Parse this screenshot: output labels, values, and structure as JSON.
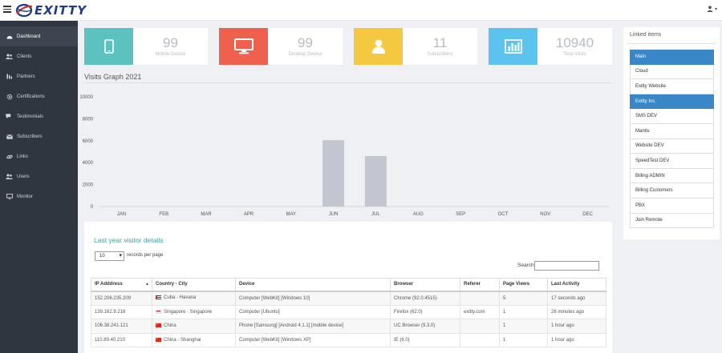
{
  "brand": {
    "name": "EXITTY"
  },
  "sidebar": {
    "items": [
      {
        "label": "Dashboard",
        "icon": "dashboard-icon",
        "active": true
      },
      {
        "label": "Clients",
        "icon": "users-icon",
        "active": false
      },
      {
        "label": "Partners",
        "icon": "partners-icon",
        "active": false
      },
      {
        "label": "Certifications",
        "icon": "gear-icon",
        "active": false
      },
      {
        "label": "Testimonials",
        "icon": "comments-icon",
        "active": false
      },
      {
        "label": "Subscribers",
        "icon": "envelope-icon",
        "active": false
      },
      {
        "label": "Links",
        "icon": "link-icon",
        "active": false
      },
      {
        "label": "Users",
        "icon": "users-icon",
        "active": false
      },
      {
        "label": "Monitor",
        "icon": "monitor-icon",
        "active": false
      }
    ]
  },
  "stats": [
    {
      "value": "99",
      "label": "Mobile Device",
      "color": "#5bc2c0",
      "icon": "mobile-icon"
    },
    {
      "value": "99",
      "label": "Desktop Device",
      "color": "#f0604f",
      "icon": "desktop-icon"
    },
    {
      "value": "11",
      "label": "Subscribers",
      "color": "#f5c842",
      "icon": "user-icon"
    },
    {
      "value": "10940",
      "label": "Total Visits",
      "color": "#5bc3ee",
      "icon": "bar-chart-icon"
    }
  ],
  "graph": {
    "title": "Visits Graph 2021"
  },
  "chart_data": {
    "type": "bar",
    "categories": [
      "JAN",
      "FEB",
      "MAR",
      "APR",
      "MAY",
      "JUN",
      "JUL",
      "AUG",
      "SEP",
      "OCT",
      "NOV",
      "DEC"
    ],
    "values": [
      0,
      0,
      0,
      0,
      0,
      6050,
      4600,
      0,
      0,
      0,
      0,
      0
    ],
    "yticks": [
      "0",
      "2000",
      "4000",
      "6000",
      "8000",
      "10000"
    ],
    "ylim": [
      0,
      10000
    ],
    "bar_color": "#c3c6d0",
    "grid": false
  },
  "visitors": {
    "title": "Last year visitor details",
    "length_value": "10",
    "length_label": "records per page",
    "search_label": "Search",
    "search_value": "",
    "columns": [
      "IP Adddress",
      "Country - City",
      "Device",
      "Browser",
      "Referer",
      "Page Views",
      "Last Activity"
    ],
    "rows": [
      {
        "ip": "152.206.235.209",
        "flag": "cuba",
        "location": "Cuba - Havana",
        "device": "Computer [WebKit] [Windows 10]",
        "browser": "Chrome (92.0.4515)",
        "referer": "",
        "views": "5",
        "last": "17 seconds ago"
      },
      {
        "ip": "139.162.9.216",
        "flag": "singapore",
        "location": "Singapore - Singapore",
        "device": "Computer [Ubuntu]",
        "browser": "Firefox (62.0)",
        "referer": "exitty.com",
        "views": "1",
        "last": "28 minutes ago"
      },
      {
        "ip": "106.38.241.121",
        "flag": "china",
        "location": "China",
        "device": "Phone [Samsung] [Android 4.1.1] [mobile device]",
        "browser": "UC Browser (9.3.0)",
        "referer": "",
        "views": "1",
        "last": "1 hour ago"
      },
      {
        "ip": "110.89.40.210",
        "flag": "china",
        "location": "China - Shanghai",
        "device": "Computer [WebKit] [Windows XP]",
        "browser": "IE (6.0)",
        "referer": "",
        "views": "1",
        "last": "1 hour ago"
      }
    ]
  },
  "linked": {
    "title": "Linked items",
    "items": [
      {
        "label": "Main",
        "active": true
      },
      {
        "label": "Cloud",
        "active": false
      },
      {
        "label": "Exitty Website",
        "active": false
      },
      {
        "label": "Exitty Inc.",
        "active": true
      },
      {
        "label": "SMS DEV",
        "active": false
      },
      {
        "label": "Mantis",
        "active": false
      },
      {
        "label": "Website DEV",
        "active": false
      },
      {
        "label": "SpeedTest DEV",
        "active": false
      },
      {
        "label": "Billing ADMIN",
        "active": false
      },
      {
        "label": "Billing Customers",
        "active": false
      },
      {
        "label": "PBX",
        "active": false
      },
      {
        "label": "Join Remote",
        "active": false
      }
    ]
  }
}
